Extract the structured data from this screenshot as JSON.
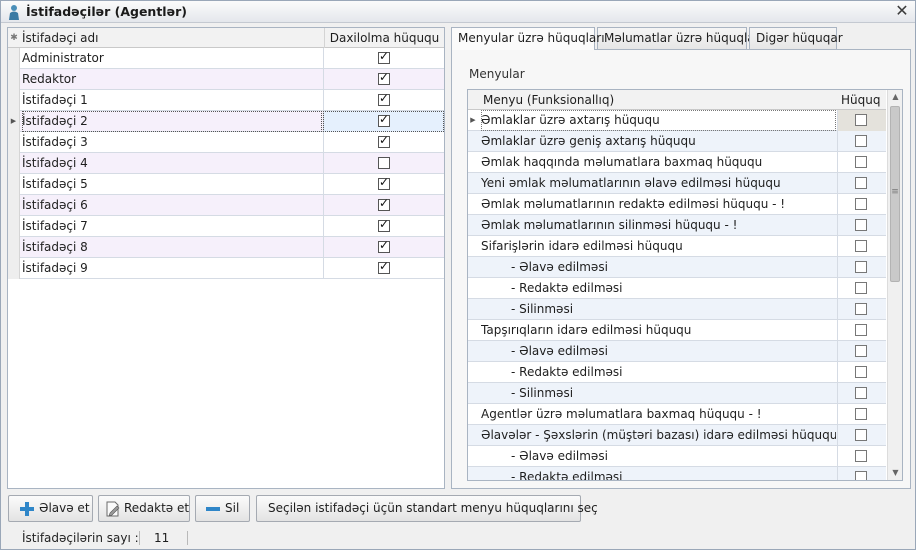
{
  "window": {
    "title": "İstifadəçilər (Agentlər)"
  },
  "users_grid": {
    "col_name": "İstifadəçi adı",
    "col_access": "Daxilolma hüququ",
    "rows": [
      {
        "name": "Administrator",
        "access": true
      },
      {
        "name": "Redaktor",
        "access": true
      },
      {
        "name": "İstifadəçi 1",
        "access": true
      },
      {
        "name": "İstifadəçi 2",
        "access": true,
        "selected": true
      },
      {
        "name": "İstifadəçi 3",
        "access": true
      },
      {
        "name": "İstifadəçi 4",
        "access": false
      },
      {
        "name": "İstifadəçi 5",
        "access": true
      },
      {
        "name": "İstifadəçi 6",
        "access": true
      },
      {
        "name": "İstifadəçi 7",
        "access": true
      },
      {
        "name": "İstifadəçi 8",
        "access": true
      },
      {
        "name": "İstifadəçi 9",
        "access": true
      }
    ]
  },
  "tabs": [
    {
      "label": "Menyular üzrə hüquqları",
      "active": true
    },
    {
      "label": "Məlumatlar üzrə hüquqlar",
      "active": false
    },
    {
      "label": "Digər hüquqar",
      "active": false
    }
  ],
  "menus_panel": {
    "label": "Menyular",
    "col_menu": "Menyu (Funksionallıq)",
    "col_right": "Hüquq",
    "rows": [
      {
        "name": "Əmlaklar üzrə axtarış hüququ",
        "sub": false,
        "checked": false,
        "selected": true
      },
      {
        "name": "Əmlaklar üzrə geniş axtarış hüququ",
        "sub": false,
        "checked": false
      },
      {
        "name": "Əmlak haqqında məlumatlara baxmaq hüququ",
        "sub": false,
        "checked": false
      },
      {
        "name": "Yeni əmlak məlumatlarının əlavə edilməsi hüququ",
        "sub": false,
        "checked": false
      },
      {
        "name": "Əmlak məlumatlarının redaktə edilməsi hüququ - !",
        "sub": false,
        "checked": false
      },
      {
        "name": "Əmlak məlumatlarının silinməsi hüququ - !",
        "sub": false,
        "checked": false
      },
      {
        "name": "Sifarişlərin idarə edilməsi hüququ",
        "sub": false,
        "checked": false
      },
      {
        "name": "- Əlavə edilməsi",
        "sub": true,
        "checked": false
      },
      {
        "name": "- Redaktə edilməsi",
        "sub": true,
        "checked": false
      },
      {
        "name": "- Silinməsi",
        "sub": true,
        "checked": false
      },
      {
        "name": "Tapşırıqların idarə edilməsi hüququ",
        "sub": false,
        "checked": false
      },
      {
        "name": "- Əlavə edilməsi",
        "sub": true,
        "checked": false
      },
      {
        "name": "- Redaktə edilməsi",
        "sub": true,
        "checked": false
      },
      {
        "name": "- Silinməsi",
        "sub": true,
        "checked": false
      },
      {
        "name": "Agentlər üzrə məlumatlara baxmaq hüququ - !",
        "sub": false,
        "checked": false
      },
      {
        "name": "Əlavələr - Şəxslərin (müştəri bazası) idarə edilməsi hüququ",
        "sub": false,
        "checked": false
      },
      {
        "name": "- Əlavə edilməsi",
        "sub": true,
        "checked": false
      },
      {
        "name": "- Redaktə edilməsi",
        "sub": true,
        "checked": false
      }
    ]
  },
  "buttons": {
    "add": "Əlavə et",
    "edit": "Redaktə et",
    "delete": "Sil",
    "apply_default": "Seçilən istifadəçi üçün standart menyu hüquqlarını seç"
  },
  "status": {
    "label": "İstifadəçilərin sayı :",
    "count": "11"
  },
  "icons": {
    "title": "user-icon",
    "add": "plus-icon",
    "edit": "edit-document-icon",
    "delete": "minus-icon",
    "close": "close-icon"
  }
}
